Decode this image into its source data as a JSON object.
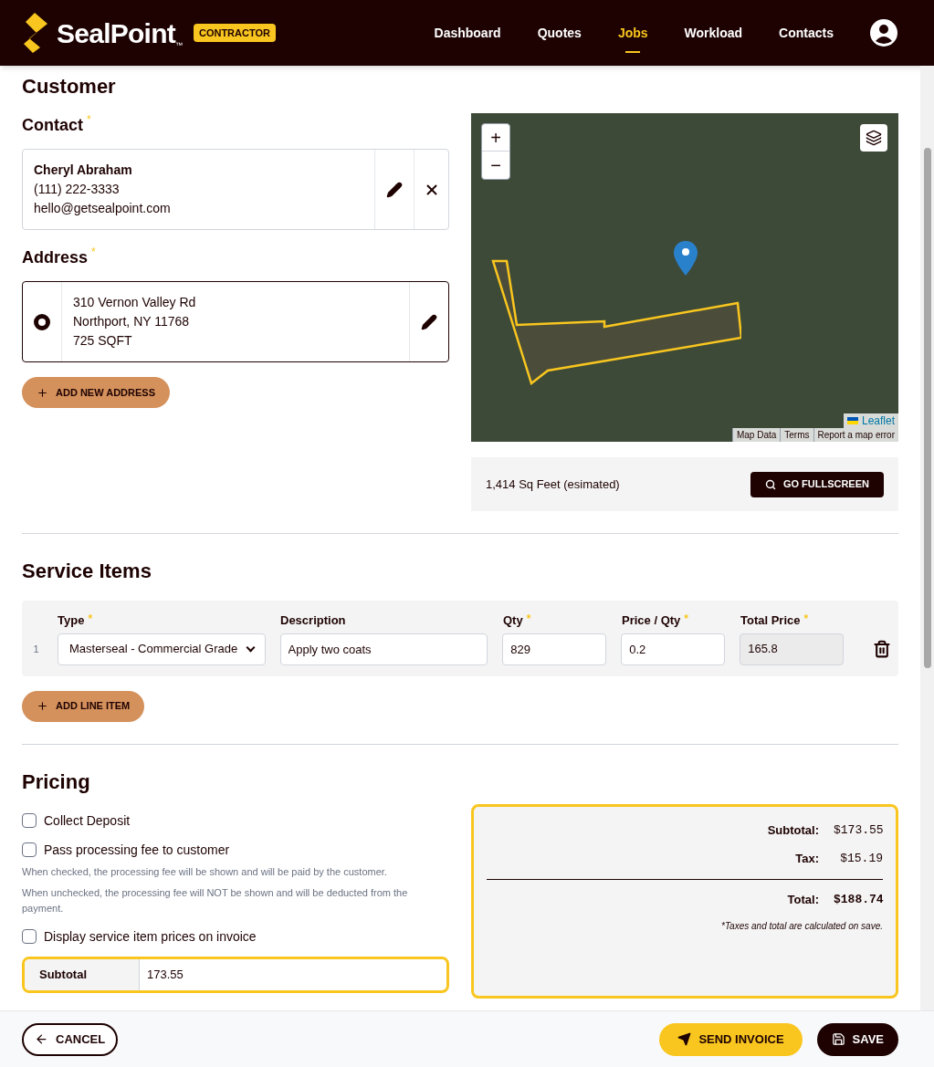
{
  "header": {
    "brand": "SealPoint",
    "trademark": "™",
    "badge": "CONTRACTOR",
    "nav": [
      {
        "label": "Dashboard",
        "selected": false
      },
      {
        "label": "Quotes",
        "selected": false
      },
      {
        "label": "Jobs",
        "selected": true
      },
      {
        "label": "Workload",
        "selected": false
      },
      {
        "label": "Contacts",
        "selected": false
      }
    ]
  },
  "customer": {
    "title": "Customer",
    "contact": {
      "label": "Contact",
      "mark": "*",
      "name": "Cheryl Abraham",
      "phone": "(111) 222-3333",
      "email": "hello@getsealpoint.com"
    },
    "address": {
      "label": "Address",
      "mark": "*",
      "selected": true,
      "lines": [
        "310 Vernon Valley Rd",
        "Northport, NY 11768",
        "725 SQFT"
      ]
    },
    "add_address": "ADD NEW ADDRESS",
    "map": {
      "zoom_in": "+",
      "zoom_out": "−",
      "attribution": "Leaflet",
      "links": [
        "Map Data",
        "Terms",
        "Report a map error"
      ],
      "area": "1,414 Sq Feet (esimated)",
      "fullscreen": "GO FULLSCREEN"
    }
  },
  "service_items": {
    "title": "Service Items",
    "columns": [
      {
        "label": "Type",
        "mark": "*"
      },
      {
        "label": "Description"
      },
      {
        "label": "Qty",
        "mark": "*"
      },
      {
        "label": "Price / Qty",
        "mark": "*"
      },
      {
        "label": "Total Price",
        "mark": "*"
      }
    ],
    "rows": [
      {
        "index": "1",
        "type": "Masterseal - Commercial Grade",
        "description": "Apply two coats",
        "qty": "829",
        "price": "0.2",
        "total": "165.8"
      }
    ],
    "add_line": "ADD LINE ITEM"
  },
  "pricing": {
    "title": "Pricing",
    "options": [
      {
        "label": "Collect Deposit",
        "checked": false
      },
      {
        "label": "Pass processing fee to customer",
        "checked": false,
        "help": [
          "When checked, the processing fee will be shown and will be paid by the customer.",
          "When unchecked, the processing fee will NOT be shown and will be deducted from the payment."
        ]
      },
      {
        "label": "Display service item prices on invoice",
        "checked": false
      }
    ],
    "subtotal_field": {
      "label": "Subtotal",
      "value": "173.55"
    },
    "summary": [
      {
        "label": "Subtotal:",
        "value": "$173.55",
        "kind": "line"
      },
      {
        "label": "Tax:",
        "value": "$15.19",
        "kind": "line"
      },
      {
        "label": "Total:",
        "value": "$188.74",
        "kind": "total"
      }
    ],
    "note": "*Taxes and total are calculated on save."
  },
  "footer": {
    "cancel": "CANCEL",
    "send": "SEND INVOICE",
    "save": "SAVE"
  }
}
